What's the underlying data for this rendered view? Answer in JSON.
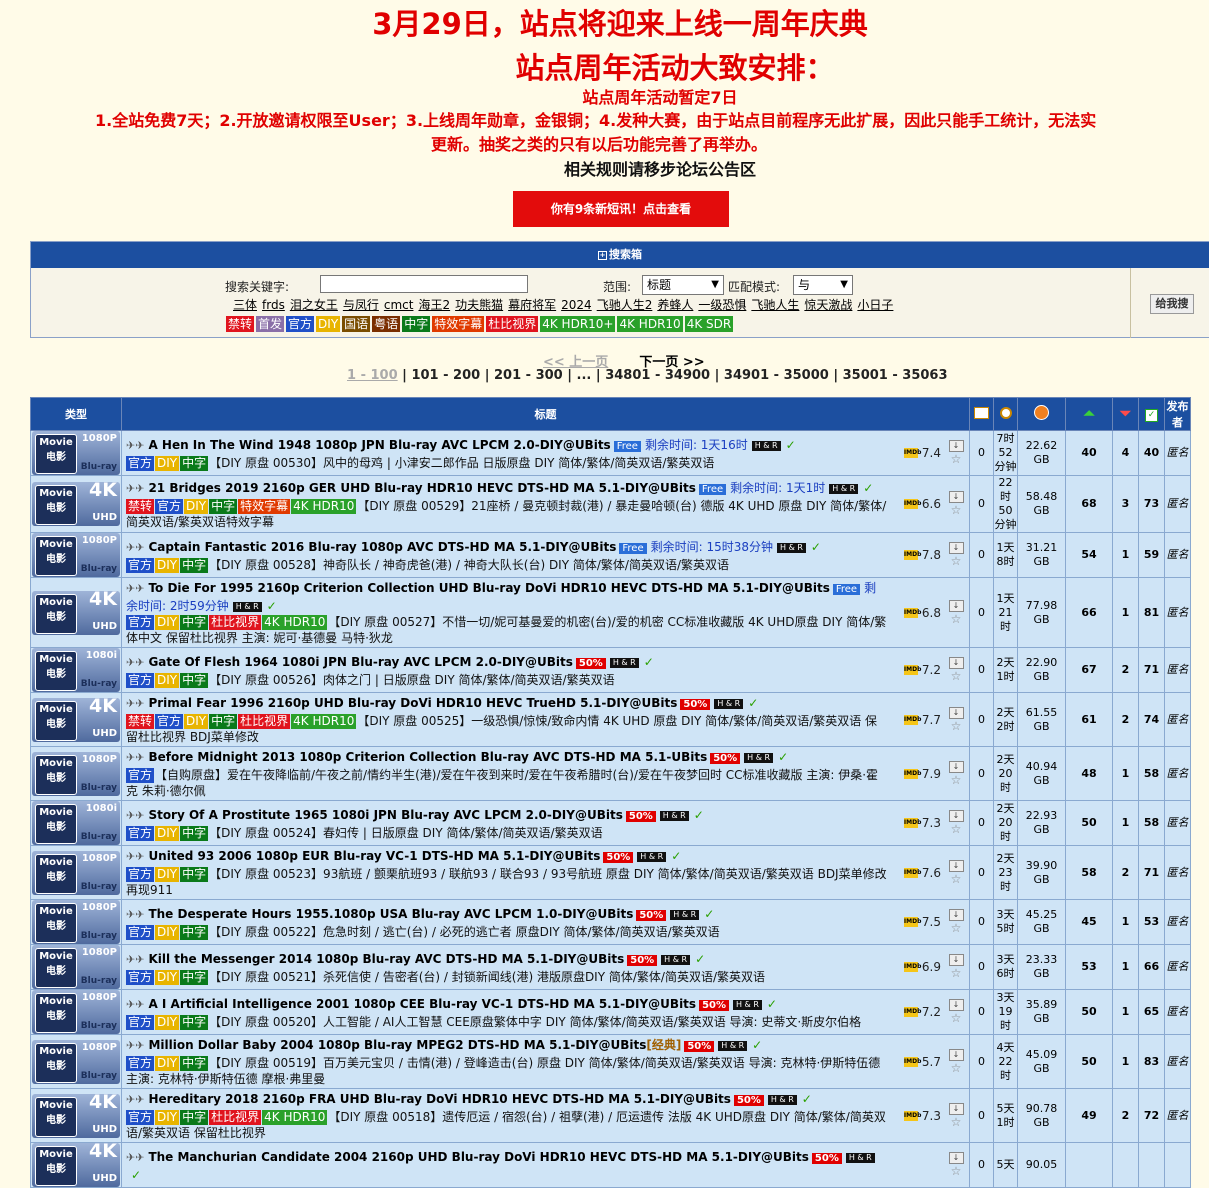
{
  "announcement": {
    "line1": "3月29日，站点将迎来上线一周年庆典",
    "line2": "站点周年活动大致安排：",
    "line3": "站点周年活动暂定7日",
    "line4": "1.全站免费7天；2.开放邀请权限至User；3.上线周年勋章，金银铜；4.发种大赛，由于站点目前程序无此扩展，因此只能手工统计，无法实",
    "line5": "更新。抽奖之类的只有以后功能完善了再举办。",
    "line6": "相关规则请移步论坛公告区",
    "message_button": "你有9条新短讯！点击查看"
  },
  "search": {
    "header": "搜索箱",
    "keyword_label": "搜索关键字:",
    "keyword_value": "",
    "scope_label": "范围:",
    "scope_value": "标题",
    "match_label": "匹配模式:",
    "match_value": "与",
    "hot_keywords": [
      "三体",
      "frds",
      "泪之女王",
      "与凤行",
      "cmct",
      "海王2",
      "功夫熊猫",
      "幕府将军",
      "2024",
      "飞驰人生2",
      "养蜂人",
      "一级恐惧",
      "飞驰人生",
      "惊天激战",
      "小日子"
    ],
    "tags": [
      {
        "label": "禁转",
        "color": "#e0141e"
      },
      {
        "label": "首发",
        "color": "#8a6fa8"
      },
      {
        "label": "官方",
        "color": "#1f4fc8"
      },
      {
        "label": "DIY",
        "color": "#e8b400"
      },
      {
        "label": "国语",
        "color": "#7a4d00"
      },
      {
        "label": "粤语",
        "color": "#7a2e00"
      },
      {
        "label": "中字",
        "color": "#0a7a1a"
      },
      {
        "label": "特效字幕",
        "color": "#e03a00"
      },
      {
        "label": "杜比视界",
        "color": "#e0141e"
      },
      {
        "label": "4K HDR10+",
        "color": "#2aa12a"
      },
      {
        "label": "4K HDR10",
        "color": "#2aa12a"
      },
      {
        "label": "4K SDR",
        "color": "#2aa12a"
      }
    ],
    "go_button": "给我搜"
  },
  "pager": {
    "prev": "<< 上一页",
    "next": "下一页 >>",
    "ranges": [
      "1 - 100",
      "101 - 200",
      "201 - 300",
      "...",
      "34801 - 34900",
      "34901 - 35000",
      "35001 - 35063"
    ]
  },
  "table": {
    "headers": {
      "type": "类型",
      "title": "标题",
      "uploader": "发布者"
    },
    "rows": [
      {
        "q": "1080P",
        "sub": "Blu-ray",
        "name": "A Hen In The Wind 1948 1080p JPN Blu-ray AVC LPCM 2.0-DIY@UBits",
        "promo": "Free",
        "remain": "剩余时间: 1天16时",
        "tags": [
          "官方",
          "DIY",
          "中字"
        ],
        "desc": "【DIY 原盘 00530】风中的母鸡 | 小津安二郎作品 日版原盘 DIY 简体/繁体/简英双语/繁英双语",
        "rating": "7.4",
        "comments": "0",
        "time": "7时\n52分钟",
        "size": "22.62\nGB",
        "seeders": "40",
        "leechers": "4",
        "done": "40",
        "uploader": "匿名"
      },
      {
        "q": "4K",
        "sub": "UHD",
        "name": "21 Bridges 2019 2160p GER UHD Blu-ray HDR10 HEVC DTS-HD MA 5.1-DIY@UBits",
        "promo": "Free",
        "remain": "剩余时间: 1天1时",
        "tags": [
          "禁转",
          "官方",
          "DIY",
          "中字",
          "特效字幕",
          "4K HDR10"
        ],
        "desc": "【DIY 原盘 00529】21座桥 / 曼克顿封裁(港) / 暴走曼哈顿(台) 德版 4K UHD 原盘 DIY 简体/繁体/简英双语/繁英双语特效字幕",
        "rating": "6.6",
        "comments": "0",
        "time": "22时\n50分钟",
        "size": "58.48\nGB",
        "seeders": "68",
        "leechers": "3",
        "done": "73",
        "uploader": "匿名"
      },
      {
        "q": "1080P",
        "sub": "Blu-ray",
        "name": "Captain Fantastic 2016 Blu-ray 1080p AVC DTS-HD MA 5.1-DIY@UBits",
        "promo": "Free",
        "remain": "剩余时间: 15时38分钟",
        "tags": [
          "官方",
          "DIY",
          "中字"
        ],
        "desc": "【DIY 原盘 00528】神奇队长 / 神奇虎爸(港) / 神奇大队长(台) DIY 简体/繁体/简英双语/繁英双语",
        "rating": "7.8",
        "comments": "0",
        "time": "1天\n8时",
        "size": "31.21\nGB",
        "seeders": "54",
        "leechers": "1",
        "done": "59",
        "uploader": "匿名"
      },
      {
        "q": "4K",
        "sub": "UHD",
        "name": "To Die For 1995 2160p Criterion Collection UHD Blu-ray DoVi HDR10 HEVC DTS-HD MA 5.1-DIY@UBits",
        "promo": "Free",
        "remain": "剩余时间: 2时59分钟",
        "tags": [
          "官方",
          "DIY",
          "中字",
          "杜比视界",
          "4K HDR10"
        ],
        "desc": "【DIY 原盘 00527】不惜一切/妮可基曼爱的机密(台)/爱的机密 CC标准收藏版 4K UHD原盘 DIY 简体/繁体中文 保留杜比视界 主演: 妮可·基德曼 马特·狄龙",
        "rating": "6.8",
        "comments": "0",
        "time": "1天\n21时",
        "size": "77.98\nGB",
        "seeders": "66",
        "leechers": "1",
        "done": "81",
        "uploader": "匿名"
      },
      {
        "q": "1080i",
        "sub": "Blu-ray",
        "name": "Gate Of Flesh 1964 1080i JPN Blu-ray AVC LPCM 2.0-DIY@UBits",
        "promo": "50%",
        "remain": "",
        "tags": [
          "官方",
          "DIY",
          "中字"
        ],
        "desc": "【DIY 原盘 00526】肉体之门 | 日版原盘 DIY 简体/繁体/简英双语/繁英双语",
        "rating": "7.2",
        "comments": "0",
        "time": "2天\n1时",
        "size": "22.90\nGB",
        "seeders": "67",
        "leechers": "2",
        "done": "71",
        "uploader": "匿名"
      },
      {
        "q": "4K",
        "sub": "UHD",
        "name": "Primal Fear 1996 2160p UHD Blu-ray DoVi HDR10 HEVC TrueHD 5.1-DIY@UBits",
        "promo": "50%",
        "remain": "",
        "tags": [
          "禁转",
          "官方",
          "DIY",
          "中字",
          "杜比视界",
          "4K HDR10"
        ],
        "desc": "【DIY 原盘 00525】一级恐惧/惊悚/致命内情 4K UHD 原盘 DIY 简体/繁体/简英双语/繁英双语 保留杜比视界 BDJ菜单修改",
        "rating": "7.7",
        "comments": "0",
        "time": "2天\n2时",
        "size": "61.55\nGB",
        "seeders": "61",
        "leechers": "2",
        "done": "74",
        "uploader": "匿名"
      },
      {
        "q": "1080P",
        "sub": "Blu-ray",
        "name": "Before Midnight 2013 1080p Criterion Collection Blu-ray AVC DTS-HD MA 5.1-UBits",
        "promo": "50%",
        "remain": "",
        "tags": [
          "官方"
        ],
        "desc": "【自购原盘】爱在午夜降临前/午夜之前/情约半生(港)/爱在午夜到来时/爱在午夜希腊时(台)/爱在午夜梦回时 CC标准收藏版 主演: 伊桑·霍克 朱莉·德尔佩",
        "rating": "7.9",
        "comments": "0",
        "time": "2天\n20时",
        "size": "40.94\nGB",
        "seeders": "48",
        "leechers": "1",
        "done": "58",
        "uploader": "匿名"
      },
      {
        "q": "1080i",
        "sub": "Blu-ray",
        "name": "Story Of A Prostitute 1965 1080i JPN Blu-ray AVC LPCM 2.0-DIY@UBits",
        "promo": "50%",
        "remain": "",
        "tags": [
          "官方",
          "DIY",
          "中字"
        ],
        "desc": "【DIY 原盘 00524】春妇传 | 日版原盘 DIY 简体/繁体/简英双语/繁英双语",
        "rating": "7.3",
        "comments": "0",
        "time": "2天\n20时",
        "size": "22.93\nGB",
        "seeders": "50",
        "leechers": "1",
        "done": "58",
        "uploader": "匿名"
      },
      {
        "q": "1080P",
        "sub": "Blu-ray",
        "name": "United 93 2006 1080p EUR Blu-ray VC-1 DTS-HD MA 5.1-DIY@UBits",
        "promo": "50%",
        "remain": "",
        "tags": [
          "官方",
          "DIY",
          "中字"
        ],
        "desc": "【DIY 原盘 00523】93航班 / 颤栗航班93 / 联航93 / 联合93 / 93号航班 原盘 DIY 简体/繁体/简英双语/繁英双语 BDJ菜单修改再现911",
        "rating": "7.6",
        "comments": "0",
        "time": "2天\n23时",
        "size": "39.90\nGB",
        "seeders": "58",
        "leechers": "2",
        "done": "71",
        "uploader": "匿名"
      },
      {
        "q": "1080P",
        "sub": "Blu-ray",
        "name": "The Desperate Hours 1955.1080p USA Blu-ray AVC LPCM 1.0-DIY@UBits",
        "promo": "50%",
        "remain": "",
        "tags": [
          "官方",
          "DIY",
          "中字"
        ],
        "desc": "【DIY 原盘 00522】危急时刻 / 逃亡(台) / 必死的逃亡者 原盘DIY 简体/繁体/简英双语/繁英双语",
        "rating": "7.5",
        "comments": "0",
        "time": "3天\n5时",
        "size": "45.25\nGB",
        "seeders": "45",
        "leechers": "1",
        "done": "53",
        "uploader": "匿名"
      },
      {
        "q": "1080P",
        "sub": "Blu-ray",
        "name": "Kill the Messenger 2014 1080p Blu-ray AVC DTS-HD MA 5.1-DIY@UBits",
        "promo": "50%",
        "remain": "",
        "tags": [
          "官方",
          "DIY",
          "中字"
        ],
        "desc": "【DIY 原盘 00521】杀死信使 / 告密者(台) / 封锁新闻线(港) 港版原盘DIY 简体/繁体/简英双语/繁英双语",
        "rating": "6.9",
        "comments": "0",
        "time": "3天\n6时",
        "size": "23.33\nGB",
        "seeders": "53",
        "leechers": "1",
        "done": "66",
        "uploader": "匿名"
      },
      {
        "q": "1080P",
        "sub": "Blu-ray",
        "name": "A I Artificial Intelligence 2001 1080p CEE Blu-ray VC-1 DTS-HD MA 5.1-DIY@UBits",
        "promo": "50%",
        "remain": "",
        "tags": [
          "官方",
          "DIY",
          "中字"
        ],
        "desc": "【DIY 原盘 00520】人工智能 / AI人工智慧 CEE原盘繁体中字 DIY 简体/繁体/简英双语/繁英双语 导演: 史蒂文·斯皮尔伯格",
        "rating": "7.2",
        "comments": "0",
        "time": "3天\n19时",
        "size": "35.89\nGB",
        "seeders": "50",
        "leechers": "1",
        "done": "65",
        "uploader": "匿名"
      },
      {
        "q": "1080P",
        "sub": "Blu-ray",
        "name": "Million Dollar Baby 2004 1080p Blu-ray MPEG2 DTS-HD MA 5.1-DIY@UBits",
        "promo": "50%",
        "jing": "[经典]",
        "remain": "",
        "tags": [
          "官方",
          "DIY",
          "中字"
        ],
        "desc": "【DIY 原盘 00519】百万美元宝贝 / 击情(港) / 登峰造击(台) 原盘 DIY 简体/繁体/简英双语/繁英双语 导演: 克林特·伊斯特伍德 主演: 克林特·伊斯特伍德 摩根·弗里曼",
        "rating": "5.7",
        "comments": "0",
        "time": "4天\n22时",
        "size": "45.09\nGB",
        "seeders": "50",
        "leechers": "1",
        "done": "83",
        "uploader": "匿名"
      },
      {
        "q": "4K",
        "sub": "UHD",
        "name": "Hereditary 2018 2160p FRA UHD Blu-ray DoVi HDR10 HEVC DTS-HD MA 5.1-DIY@UBits",
        "promo": "50%",
        "remain": "",
        "tags": [
          "官方",
          "DIY",
          "中字",
          "杜比视界",
          "4K HDR10"
        ],
        "desc": "【DIY 原盘 00518】遗传厄运 / 宿怨(台) / 祖孽(港) / 厄运遗传 法版 4K UHD原盘 DIY 简体/繁体/简英双语/繁英双语 保留杜比视界",
        "rating": "7.3",
        "comments": "0",
        "time": "5天\n1时",
        "size": "90.78\nGB",
        "seeders": "49",
        "leechers": "2",
        "done": "72",
        "uploader": "匿名"
      },
      {
        "q": "4K",
        "sub": "UHD",
        "name": "The Manchurian Candidate 2004 2160p UHD Blu-ray DoVi HDR10 HEVC DTS-HD MA 5.1-DIY@UBits",
        "promo": "50%",
        "remain": "",
        "tags": [],
        "desc": "",
        "rating": "",
        "comments": "0",
        "time": "5天",
        "size": "90.05",
        "seeders": "",
        "leechers": "",
        "done": "",
        "uploader": ""
      }
    ]
  },
  "movie_badge": "Movie\n电影",
  "hr_label": "H & R",
  "colors": {
    "header_blue": "#1c4fa0",
    "row_bg": "#cfe4f6",
    "announce_red": "#e00000"
  }
}
